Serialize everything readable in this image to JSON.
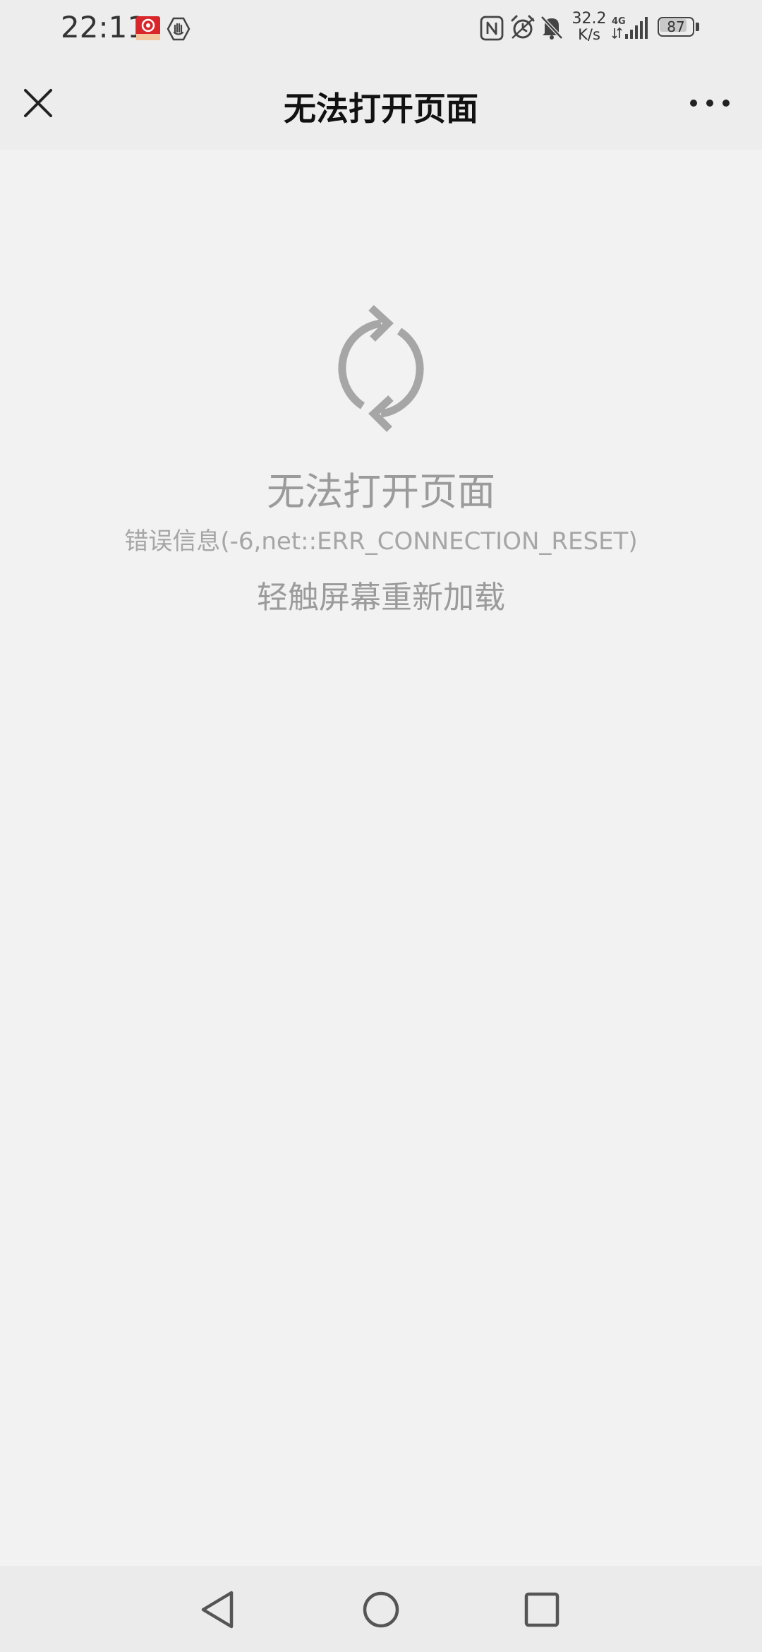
{
  "status_bar": {
    "time": "22:11",
    "net_speed_value": "32.2",
    "net_speed_unit": "K/s",
    "network_type": "4G",
    "battery_level": "87",
    "battery_fraction": 0.87,
    "icons": [
      "app-badge-icon",
      "hand-shield-icon",
      "nfc-icon",
      "alarm-icon",
      "mute-icon",
      "signal-icon",
      "battery-icon"
    ]
  },
  "header": {
    "title": "无法打开页面",
    "close_icon": "close-icon",
    "more_icon": "more-dots-icon"
  },
  "error": {
    "icon": "refresh-icon",
    "title": "无法打开页面",
    "detail": "错误信息(-6,net::ERR_CONNECTION_RESET)",
    "hint": "轻触屏幕重新加载"
  },
  "nav_bar": {
    "icons": [
      "back-triangle-icon",
      "home-circle-icon",
      "recents-square-icon"
    ]
  },
  "colors": {
    "bar_background": "#ededed",
    "page_background": "#f2f2f2",
    "error_text": "#9b9b9b",
    "icon_gray": "#a6a6a6"
  }
}
